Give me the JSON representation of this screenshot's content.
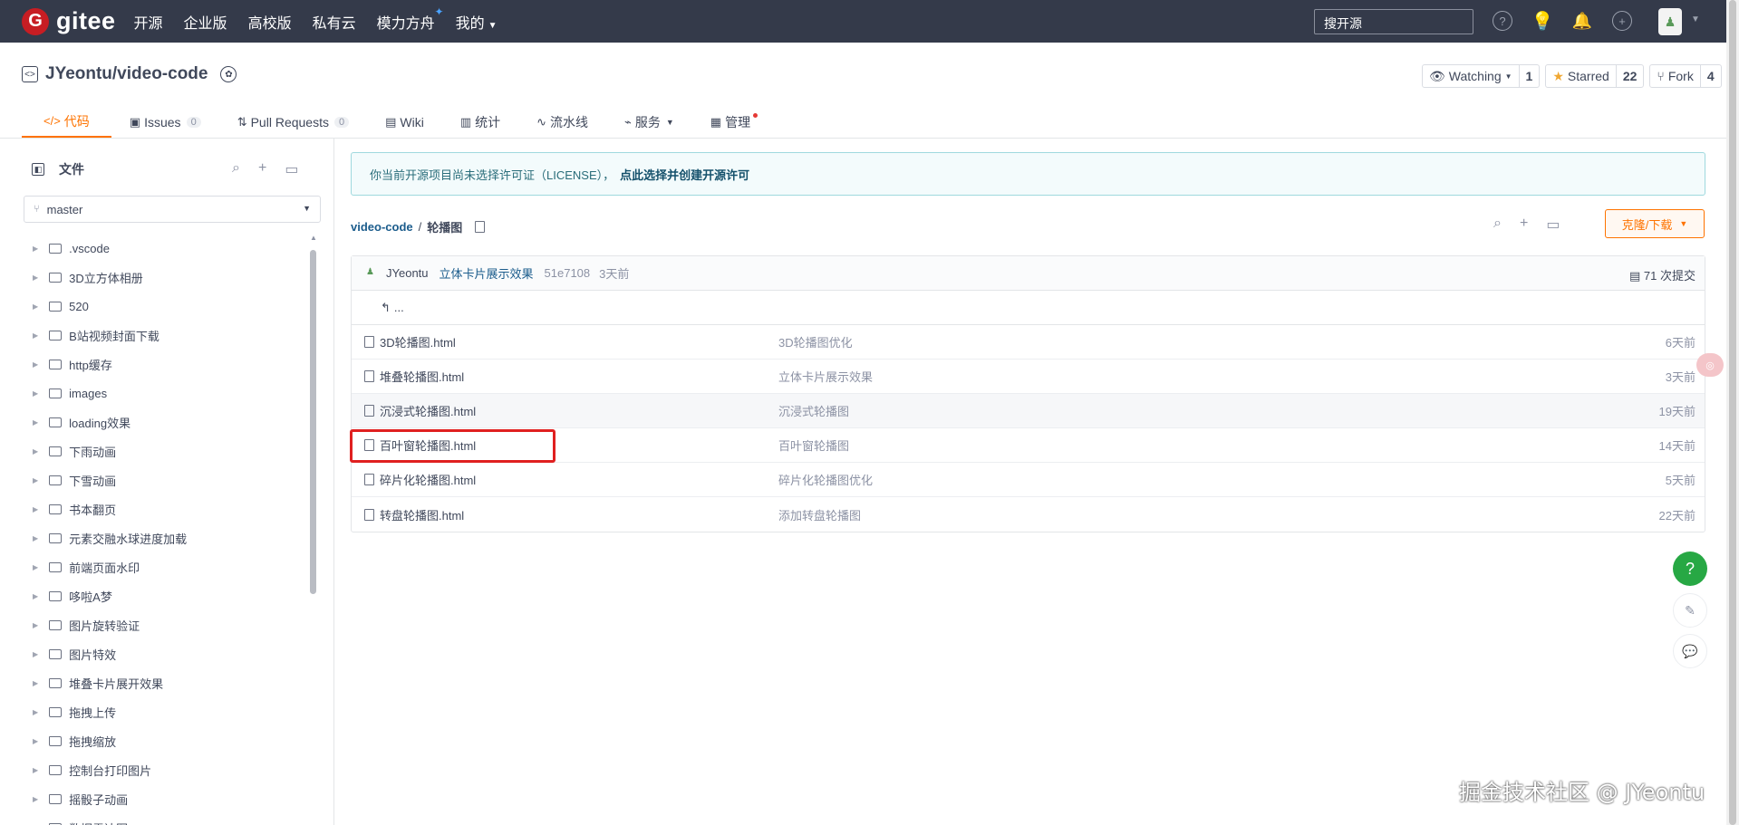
{
  "topbar": {
    "logo_mark": "G",
    "logo_text": "gitee",
    "nav": [
      "开源",
      "企业版",
      "高校版",
      "私有云",
      "模力方舟",
      "我的"
    ],
    "search_placeholder": "搜开源"
  },
  "repo": {
    "name": "JYeontu/video-code",
    "watching_label": "Watching",
    "watching_count": "1",
    "starred_label": "Starred",
    "starred_count": "22",
    "fork_label": "Fork",
    "fork_count": "4"
  },
  "tabs": [
    {
      "label": "代码"
    },
    {
      "label": "Issues",
      "count": "0"
    },
    {
      "label": "Pull Requests",
      "count": "0"
    },
    {
      "label": "Wiki"
    },
    {
      "label": "统计"
    },
    {
      "label": "流水线"
    },
    {
      "label": "服务"
    },
    {
      "label": "管理"
    }
  ],
  "sidebar": {
    "title": "文件",
    "branch": "master",
    "tree": [
      ".vscode",
      "3D立方体相册",
      "520",
      "B站视频封面下载",
      "http缓存",
      "images",
      "loading效果",
      "下雨动画",
      "下雪动画",
      "书本翻页",
      "元素交融水球进度加载",
      "前端页面水印",
      "哆啦A梦",
      "图片旋转验证",
      "图片特效",
      "堆叠卡片展开效果",
      "拖拽上传",
      "拖拽缩放",
      "控制台打印图片",
      "摇骰子动画",
      "数据雷达图"
    ]
  },
  "license": {
    "text": "你当前开源项目尚未选择许可证（LICENSE），",
    "link": "点此选择并创建开源许可"
  },
  "breadcrumb": {
    "root": "video-code",
    "sep": "/",
    "current": "轮播图"
  },
  "clone_label": "克隆/下载",
  "commit": {
    "author": "JYeontu",
    "message": "立体卡片展示效果",
    "hash": "51e7108",
    "time": "3天前",
    "total": "71 次提交"
  },
  "back_label": "...",
  "files": [
    {
      "name": "3D轮播图.html",
      "message": "3D轮播图优化",
      "time": "6天前"
    },
    {
      "name": "堆叠轮播图.html",
      "message": "立体卡片展示效果",
      "time": "3天前"
    },
    {
      "name": "沉浸式轮播图.html",
      "message": "沉浸式轮播图",
      "time": "19天前"
    },
    {
      "name": "百叶窗轮播图.html",
      "message": "百叶窗轮播图",
      "time": "14天前"
    },
    {
      "name": "碎片化轮播图.html",
      "message": "碎片化轮播图优化",
      "time": "5天前"
    },
    {
      "name": "转盘轮播图.html",
      "message": "添加转盘轮播图",
      "time": "22天前"
    }
  ],
  "float": {
    "help": "?"
  },
  "watermark": "掘金技术社区 @ JYeontu",
  "colors": {
    "accent": "#fe7300",
    "topbar": "#343a4a",
    "highlight_box": "#e02020",
    "help_button": "#27a844"
  }
}
